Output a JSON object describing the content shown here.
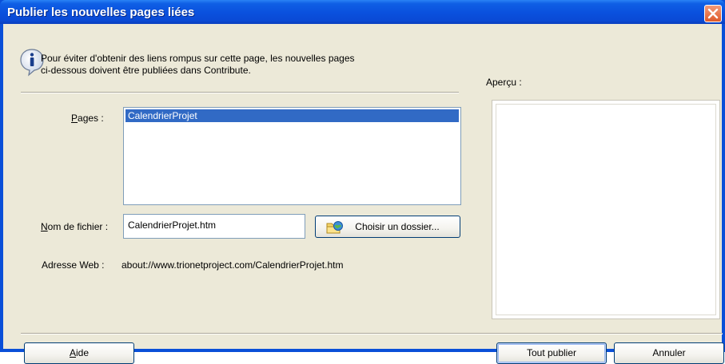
{
  "window": {
    "title": "Publier les nouvelles pages liées"
  },
  "info": {
    "message_line1": "Pour éviter d'obtenir des liens rompus sur cette page, les nouvelles pages",
    "message_line2": "ci-dessous doivent être publiées dans Contribute."
  },
  "pages": {
    "label_mnemonic": "P",
    "label_rest": "ages :",
    "items": [
      "CalendrierProjet"
    ],
    "selected": "CalendrierProjet"
  },
  "filename": {
    "label_mnemonic": "N",
    "label_rest": "om de fichier :",
    "value": "CalendrierProjet.htm",
    "browse_label": "Choisir un dossier..."
  },
  "web_address": {
    "label": "Adresse Web :",
    "value": "about://www.trionetproject.com/CalendrierProjet.htm"
  },
  "preview": {
    "label": "Aperçu :"
  },
  "buttons": {
    "help_mnemonic": "A",
    "help_rest": "ide",
    "publish_all": "Tout publier",
    "cancel": "Annuler"
  },
  "icons": {
    "info": "info-icon",
    "close": "close-icon",
    "folder": "folder-globe-icon"
  }
}
